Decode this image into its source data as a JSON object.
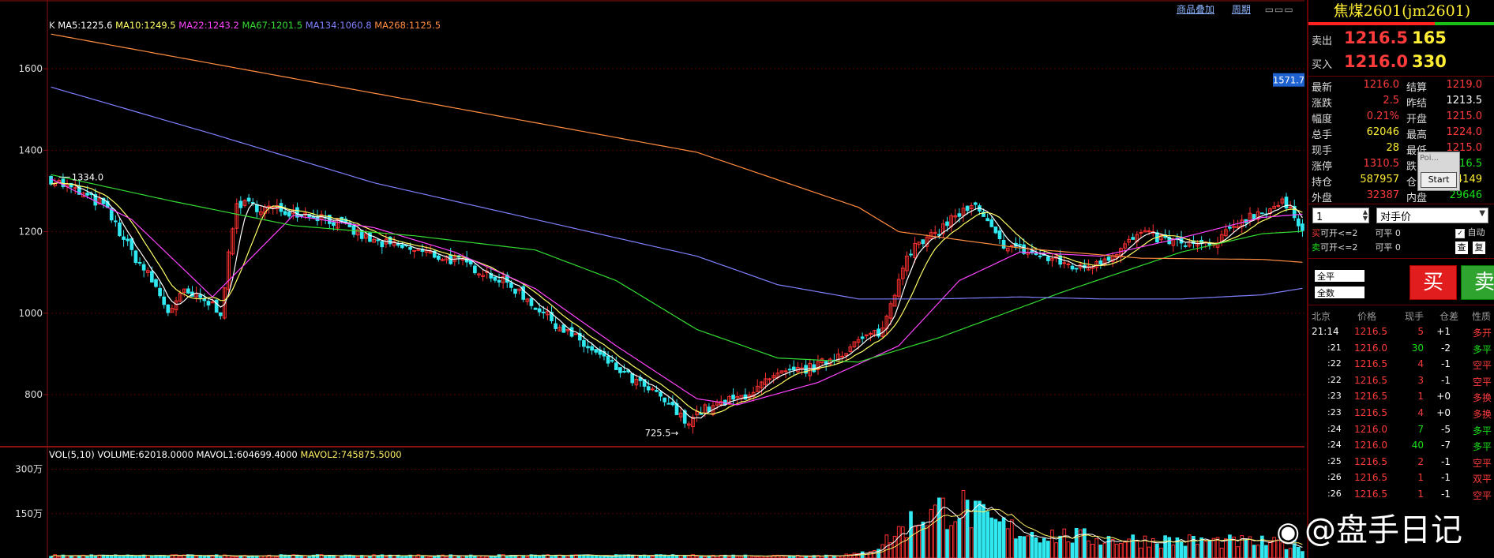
{
  "top_links": {
    "overlay": "商品叠加",
    "period": "周期"
  },
  "chart_data": [
    {
      "type": "candlestick",
      "panel": "price",
      "kind_label": "K",
      "indicators": [
        {
          "name": "MA5",
          "value": "1225.6",
          "color": "#ffffff"
        },
        {
          "name": "MA10",
          "value": "1249.5",
          "color": "#ffff66"
        },
        {
          "name": "MA22",
          "value": "1243.2",
          "color": "#ff44ff"
        },
        {
          "name": "MA67",
          "value": "1201.5",
          "color": "#33dd33"
        },
        {
          "name": "MA134",
          "value": "1060.8",
          "color": "#8080ff"
        },
        {
          "name": "MA268",
          "value": "1125.5",
          "color": "#ff8c40"
        }
      ],
      "ylim": [
        680,
        1730
      ],
      "yticks": [
        800,
        1000,
        1200,
        1400,
        1600
      ],
      "current_price_tag": "1571.7",
      "annotations": [
        {
          "text": "1334.0",
          "y": 1334
        },
        {
          "text": "725.5",
          "y": 725.5
        }
      ],
      "close_anchors": [
        [
          0,
          1330
        ],
        [
          8,
          1290
        ],
        [
          13,
          1265
        ],
        [
          20,
          1150
        ],
        [
          25,
          1080
        ],
        [
          29,
          1005
        ],
        [
          33,
          1050
        ],
        [
          40,
          1020
        ],
        [
          42,
          1005
        ],
        [
          46,
          1270
        ],
        [
          55,
          1255
        ],
        [
          60,
          1250
        ],
        [
          68,
          1235
        ],
        [
          80,
          1175
        ],
        [
          90,
          1155
        ],
        [
          100,
          1130
        ],
        [
          108,
          1100
        ],
        [
          115,
          1060
        ],
        [
          125,
          975
        ],
        [
          135,
          900
        ],
        [
          145,
          830
        ],
        [
          152,
          785
        ],
        [
          157,
          735
        ],
        [
          161,
          760
        ],
        [
          170,
          790
        ],
        [
          180,
          845
        ],
        [
          190,
          870
        ],
        [
          200,
          930
        ],
        [
          206,
          960
        ],
        [
          212,
          1150
        ],
        [
          218,
          1185
        ],
        [
          224,
          1240
        ],
        [
          229,
          1260
        ],
        [
          235,
          1175
        ],
        [
          245,
          1140
        ],
        [
          255,
          1110
        ],
        [
          262,
          1140
        ],
        [
          270,
          1195
        ],
        [
          280,
          1170
        ],
        [
          288,
          1165
        ],
        [
          295,
          1230
        ],
        [
          300,
          1250
        ],
        [
          305,
          1270
        ],
        [
          310,
          1215
        ]
      ],
      "ma_anchors": {
        "MA22": [
          [
            0,
            1330
          ],
          [
            20,
            1230
          ],
          [
            40,
            1040
          ],
          [
            60,
            1240
          ],
          [
            80,
            1210
          ],
          [
            100,
            1150
          ],
          [
            120,
            1060
          ],
          [
            140,
            920
          ],
          [
            160,
            790
          ],
          [
            170,
            775
          ],
          [
            190,
            830
          ],
          [
            210,
            920
          ],
          [
            225,
            1080
          ],
          [
            240,
            1150
          ],
          [
            260,
            1140
          ],
          [
            280,
            1185
          ],
          [
            300,
            1235
          ],
          [
            310,
            1243
          ]
        ],
        "MA67": [
          [
            0,
            1340
          ],
          [
            30,
            1275
          ],
          [
            60,
            1215
          ],
          [
            90,
            1190
          ],
          [
            120,
            1155
          ],
          [
            140,
            1080
          ],
          [
            160,
            960
          ],
          [
            180,
            890
          ],
          [
            200,
            880
          ],
          [
            220,
            940
          ],
          [
            250,
            1050
          ],
          [
            280,
            1150
          ],
          [
            300,
            1195
          ],
          [
            310,
            1201
          ]
        ],
        "MA134": [
          [
            0,
            1555
          ],
          [
            40,
            1440
          ],
          [
            80,
            1320
          ],
          [
            120,
            1230
          ],
          [
            160,
            1140
          ],
          [
            180,
            1070
          ],
          [
            200,
            1035
          ],
          [
            220,
            1035
          ],
          [
            240,
            1040
          ],
          [
            260,
            1035
          ],
          [
            280,
            1035
          ],
          [
            300,
            1045
          ],
          [
            310,
            1061
          ]
        ],
        "MA268": [
          [
            0,
            1685
          ],
          [
            80,
            1540
          ],
          [
            160,
            1395
          ],
          [
            200,
            1260
          ],
          [
            210,
            1200
          ],
          [
            240,
            1160
          ],
          [
            270,
            1135
          ],
          [
            300,
            1132
          ],
          [
            310,
            1125
          ]
        ]
      },
      "bar_count": 311
    },
    {
      "type": "bar",
      "panel": "volume",
      "indicators": [
        {
          "name": "VOL(5,10)",
          "value": "",
          "color": "#ffffff"
        },
        {
          "name": "VOLUME",
          "value": "62018.0000",
          "color": "#ffffff"
        },
        {
          "name": "MAVOL1",
          "value": "604699.4000",
          "color": "#ffffff"
        },
        {
          "name": "MAVOL2",
          "value": "745875.5000",
          "color": "#ffee66"
        }
      ],
      "unit": "万",
      "yticks": [
        "300万",
        "150万"
      ],
      "ytick_values": [
        300,
        150
      ],
      "ylim": [
        0,
        360
      ],
      "volume_anchors": [
        [
          0,
          8
        ],
        [
          190,
          8
        ],
        [
          200,
          12
        ],
        [
          205,
          40
        ],
        [
          210,
          90
        ],
        [
          215,
          140
        ],
        [
          220,
          160
        ],
        [
          225,
          175
        ],
        [
          232,
          120
        ],
        [
          240,
          90
        ],
        [
          250,
          75
        ],
        [
          260,
          65
        ],
        [
          270,
          60
        ],
        [
          280,
          58
        ],
        [
          290,
          55
        ],
        [
          300,
          52
        ],
        [
          310,
          40
        ]
      ]
    }
  ],
  "panel": {
    "title": "焦煤2601(jm2601)",
    "sell": {
      "label": "卖出",
      "price": "1216.5",
      "qty": "165"
    },
    "buy": {
      "label": "买入",
      "price": "1216.0",
      "qty": "330"
    },
    "stats": [
      {
        "l1": "最新",
        "v1": "1216.0",
        "l2": "结算",
        "v2": "1219.0"
      },
      {
        "l1": "涨跌",
        "v1": "2.5",
        "l2": "昨结",
        "v2": "1213.5"
      },
      {
        "l1": "幅度",
        "v1": "0.21%",
        "l2": "开盘",
        "v2": "1215.0"
      },
      {
        "l1": "总手",
        "v1": "62046",
        "l2": "最高",
        "v2": "1224.0"
      },
      {
        "l1": "现手",
        "v1": "28",
        "l2": "最低",
        "v2": "1215.0"
      },
      {
        "l1": "涨停",
        "v1": "1310.5",
        "l2": "跌",
        "v2": "1116.5"
      },
      {
        "l1": "持仓",
        "v1": "587957",
        "l2": "仓",
        "v2": "-4149"
      },
      {
        "l1": "外盘",
        "v1": "32387",
        "l2": "内盘",
        "v2": "29646"
      }
    ],
    "popup": {
      "text": "Poi...",
      "button": "Start"
    },
    "order": {
      "qty": "1",
      "price_type": "对手价",
      "buy_label": "买",
      "open_buy": "可开<=2",
      "close_buy": "可平 0",
      "sell_label": "卖",
      "open_sell": "可开<=2",
      "close_sell": "可平 0",
      "auto": "自动",
      "check": "查",
      "reset": "复",
      "flat_all": "全平",
      "all_qty": "全数",
      "buy_button": "买",
      "sell_button": "卖"
    },
    "ticks_header": [
      "北京",
      "价格",
      "现手",
      "仓差",
      "性质"
    ],
    "ticks": [
      {
        "time": "21:14",
        "price": "1216.5",
        "vol": "5",
        "diff": "+1",
        "nature": "多开",
        "vc": "red",
        "nc": "red"
      },
      {
        "time": ":21",
        "price": "1216.0",
        "vol": "30",
        "diff": "-2",
        "nature": "多平",
        "vc": "green",
        "nc": "green"
      },
      {
        "time": ":22",
        "price": "1216.5",
        "vol": "4",
        "diff": "-1",
        "nature": "空平",
        "vc": "red",
        "nc": "red"
      },
      {
        "time": ":22",
        "price": "1216.5",
        "vol": "3",
        "diff": "-1",
        "nature": "空平",
        "vc": "red",
        "nc": "red"
      },
      {
        "time": ":23",
        "price": "1216.5",
        "vol": "1",
        "diff": "+0",
        "nature": "多换",
        "vc": "red",
        "nc": "red"
      },
      {
        "time": ":23",
        "price": "1216.5",
        "vol": "4",
        "diff": "+0",
        "nature": "多换",
        "vc": "red",
        "nc": "red"
      },
      {
        "time": ":24",
        "price": "1216.0",
        "vol": "7",
        "diff": "-5",
        "nature": "多平",
        "vc": "green",
        "nc": "green"
      },
      {
        "time": ":24",
        "price": "1216.0",
        "vol": "40",
        "diff": "-7",
        "nature": "多平",
        "vc": "green",
        "nc": "green"
      },
      {
        "time": ":25",
        "price": "1216.5",
        "vol": "2",
        "diff": "-1",
        "nature": "空平",
        "vc": "red",
        "nc": "red"
      },
      {
        "time": ":26",
        "price": "1216.5",
        "vol": "1",
        "diff": "-1",
        "nature": "双平",
        "vc": "red",
        "nc": "red"
      },
      {
        "time": ":26",
        "price": "1216.5",
        "vol": "1",
        "diff": "-1",
        "nature": "空平",
        "vc": "red",
        "nc": "red"
      }
    ]
  },
  "watermark": "@盘手日记"
}
